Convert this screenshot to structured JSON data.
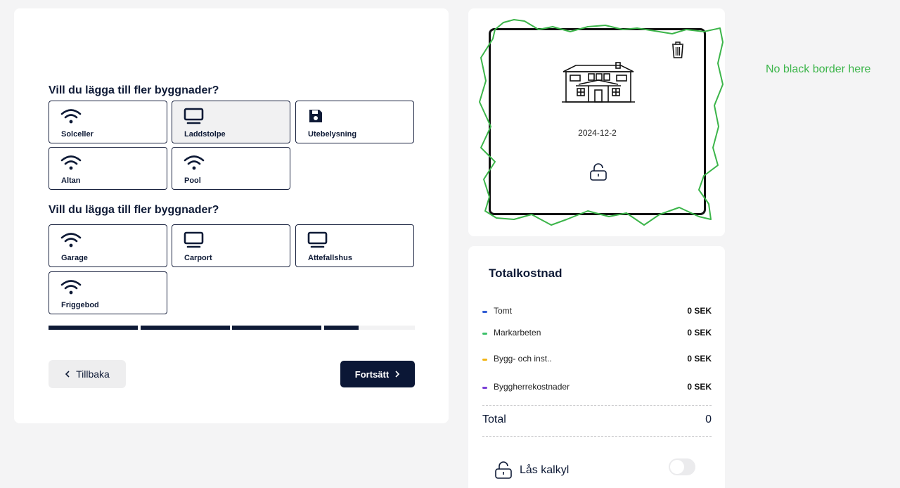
{
  "form": {
    "section1_title": "Vill du lägga till fler byggnader?",
    "section1_options": [
      {
        "label": "Solceller",
        "icon": "wifi-icon",
        "selected": false
      },
      {
        "label": "Laddstolpe",
        "icon": "monitor-icon",
        "selected": true
      },
      {
        "label": "Utebelysning",
        "icon": "floppy-disk-icon",
        "selected": false
      },
      {
        "label": "Altan",
        "icon": "wifi-icon",
        "selected": false
      },
      {
        "label": "Pool",
        "icon": "wifi-icon",
        "selected": false
      }
    ],
    "section2_title": "Vill du lägga till fler byggnader?",
    "section2_options": [
      {
        "label": "Garage",
        "icon": "wifi-icon",
        "selected": false
      },
      {
        "label": "Carport",
        "icon": "monitor-icon",
        "selected": false
      },
      {
        "label": "Attefallshus",
        "icon": "monitor-icon",
        "selected": false
      },
      {
        "label": "Friggebod",
        "icon": "wifi-icon",
        "selected": false
      }
    ],
    "progress_steps": [
      1.0,
      1.0,
      1.0,
      0.38
    ],
    "back_label": "Tillbaka",
    "next_label": "Fortsätt"
  },
  "house_card": {
    "date": "2024-12-2",
    "icons": [
      "trash-icon",
      "house-icon",
      "unlock-icon"
    ]
  },
  "annotation": {
    "note": "No black border here",
    "color": "#3cb54a"
  },
  "cost": {
    "title": "Totalkostnad",
    "rows": [
      {
        "label": "Tomt",
        "value": "0 SEK",
        "color": "#2f5bd3"
      },
      {
        "label": "Markarbeten",
        "value": "0 SEK",
        "color": "#3cc06a"
      },
      {
        "label": "Bygg- och inst..",
        "value": "0 SEK",
        "color": "#f2b515"
      },
      {
        "label": "Byggherrekostnader",
        "value": "0 SEK",
        "color": "#7a3fd6"
      }
    ],
    "total_label": "Total",
    "total_value": "0",
    "lock_label": "Lås kalkyl",
    "lock_enabled": false
  }
}
